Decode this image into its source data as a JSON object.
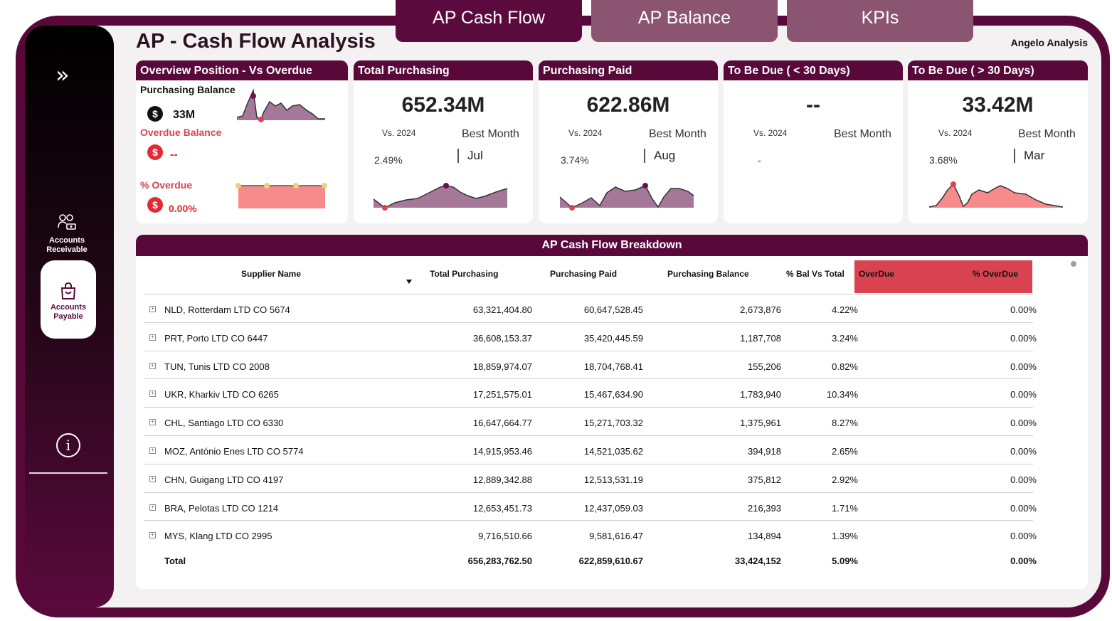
{
  "tabs": [
    "AP Cash Flow",
    "AP Balance",
    "KPIs"
  ],
  "title": "AP - Cash Flow Analysis",
  "author": "Angelo Analysis",
  "sidebar": {
    "expand_icon": "»",
    "items": [
      {
        "label1": "Accounts",
        "label2": "Receivable"
      },
      {
        "label1": "Accounts",
        "label2": "Payable"
      }
    ],
    "info_icon": "i"
  },
  "overview": {
    "title": "Overview Position - Vs Overdue",
    "purchasing_balance_label": "Purchasing Balance",
    "purchasing_balance_value": "33M",
    "overdue_balance_label": "Overdue Balance",
    "overdue_balance_value": "--",
    "pct_overdue_label": "% Overdue",
    "pct_overdue_value": "0.00%",
    "dollar": "$"
  },
  "kpis": [
    {
      "title": "Total Purchasing",
      "value": "652.34M",
      "vs": "Vs. 2024",
      "best": "Best Month",
      "pct": "2.49%",
      "month": "Jul"
    },
    {
      "title": "Purchasing Paid",
      "value": "622.86M",
      "vs": "Vs. 2024",
      "best": "Best Month",
      "pct": "3.74%",
      "month": "Aug"
    },
    {
      "title": "To Be Due ( < 30 Days)",
      "value": "--",
      "vs": "Vs. 2024",
      "best": "Best Month",
      "pct": "-",
      "month": ""
    },
    {
      "title": "To Be Due ( > 30 Days)",
      "value": "33.42M",
      "vs": "Vs. 2024",
      "best": "Best Month",
      "pct": "3.68%",
      "month": "Mar"
    }
  ],
  "colors": {
    "maroon": "#58093a",
    "mauve": "#a5789a",
    "salmon": "#f78a8a",
    "red": "#d9434f",
    "tab_inactive": "#8b5470"
  },
  "table": {
    "title": "AP Cash Flow Breakdown",
    "columns": [
      "Supplier Name",
      "Total Purchasing",
      "Purchasing Paid",
      "Purchasing Balance",
      "% Bal Vs Total",
      "OverDue",
      "% OverDue"
    ],
    "rows": [
      [
        "NLD, Rotterdam LTD CO 5674",
        "63,321,404.80",
        "60,647,528.45",
        "2,673,876",
        "4.22%",
        "",
        "0.00%"
      ],
      [
        "PRT, Porto LTD CO 6447",
        "36,608,153.37",
        "35,420,445.59",
        "1,187,708",
        "3.24%",
        "",
        "0.00%"
      ],
      [
        "TUN, Tunis LTD CO 2008",
        "18,859,974.07",
        "18,704,768.41",
        "155,206",
        "0.82%",
        "",
        "0.00%"
      ],
      [
        "UKR, Kharkiv LTD CO 6265",
        "17,251,575.01",
        "15,467,634.90",
        "1,783,940",
        "10.34%",
        "",
        "0.00%"
      ],
      [
        "CHL, Santiago LTD CO 6330",
        "16,647,664.77",
        "15,271,703.32",
        "1,375,961",
        "8.27%",
        "",
        "0.00%"
      ],
      [
        "MOZ, António Enes LTD CO 5774",
        "14,915,953.46",
        "14,521,035.62",
        "394,918",
        "2.65%",
        "",
        "0.00%"
      ],
      [
        "CHN, Guigang LTD CO 4197",
        "12,889,342.88",
        "12,513,531.19",
        "375,812",
        "2.92%",
        "",
        "0.00%"
      ],
      [
        "BRA, Pelotas LTD CO 1214",
        "12,653,451.73",
        "12,437,059.03",
        "216,393",
        "1.71%",
        "",
        "0.00%"
      ],
      [
        "MYS, Klang LTD CO 2995",
        "9,716,510.66",
        "9,581,616.47",
        "134,894",
        "1.39%",
        "",
        "0.00%"
      ]
    ],
    "total": [
      "Total",
      "656,283,762.50",
      "622,859,610.67",
      "33,424,152",
      "5.09%",
      "",
      "0.00%"
    ]
  }
}
